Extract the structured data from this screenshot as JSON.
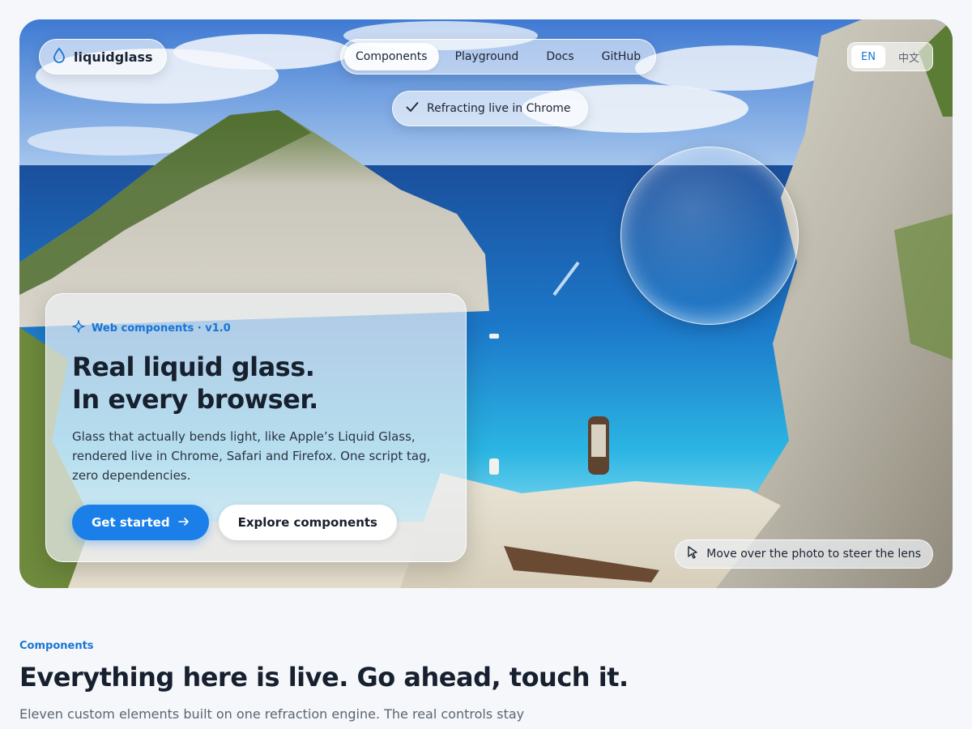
{
  "brand": {
    "name": "liquidglass",
    "icon": "water-drop-icon"
  },
  "nav": {
    "items": [
      {
        "label": "Components",
        "active": true
      },
      {
        "label": "Playground",
        "active": false
      },
      {
        "label": "Docs",
        "active": false
      },
      {
        "label": "GitHub",
        "active": false
      }
    ]
  },
  "language": {
    "options": [
      {
        "label": "EN",
        "active": true
      },
      {
        "label": "中文",
        "active": false
      }
    ]
  },
  "status": {
    "label": "Refracting live in Chrome",
    "icon": "check-icon"
  },
  "hero_card": {
    "eyebrow": "Web components · v1.0",
    "eyebrow_icon": "sparkle-icon",
    "title_line1": "Real liquid glass.",
    "title_line2": "In every browser.",
    "description": "Glass that actually bends light, like Apple’s Liquid Glass, rendered live in Chrome, Safari and Firefox. One script tag, zero dependencies.",
    "primary_cta": "Get started",
    "primary_cta_icon": "arrow-right-icon",
    "secondary_cta": "Explore components"
  },
  "hint": {
    "label": "Move over the photo to steer the lens",
    "icon": "cursor-arrow-icon"
  },
  "section": {
    "eyebrow": "Components",
    "title": "Everything here is live. Go ahead, touch it.",
    "description": "Eleven custom elements built on one refraction engine. The real controls stay native"
  },
  "colors": {
    "accent": "#1a7fe8",
    "accent_text": "#1774d6",
    "page_background": "#f5f7fa",
    "heading": "#17202e",
    "muted": "#5b6573"
  }
}
